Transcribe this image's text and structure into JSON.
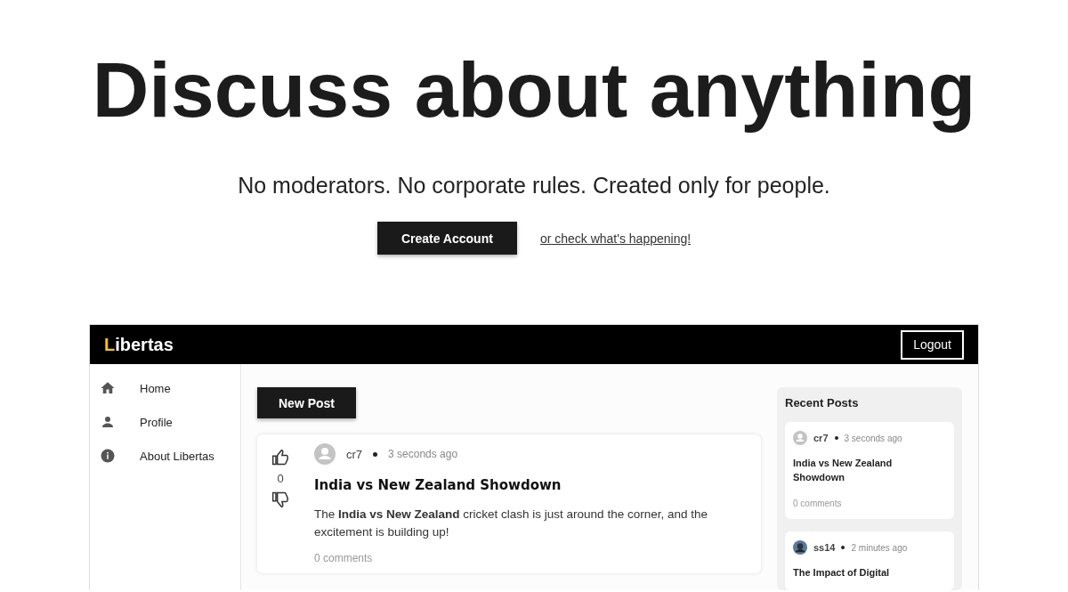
{
  "hero": {
    "title": "Discuss about anything",
    "subtitle": "No moderators. No corporate rules. Created only for people.",
    "primary_button": "Create Account",
    "link": "or check what's happening!"
  },
  "app": {
    "logo": {
      "initial": "L",
      "rest": "ibertas"
    },
    "logout": "Logout",
    "sidebar": {
      "items": [
        {
          "kind": "home",
          "label": "Home"
        },
        {
          "kind": "profile",
          "label": "Profile"
        },
        {
          "kind": "info",
          "label": "About Libertas"
        }
      ]
    },
    "new_post_button": "New Post",
    "posts": [
      {
        "votes": "0",
        "author": "cr7",
        "kind": "default",
        "time": "3 seconds ago",
        "title": "India vs New Zealand Showdown",
        "body": "The **India vs New Zealand** cricket clash is just around the corner, and the excitement is building up!",
        "comments": "0 comments"
      }
    ],
    "recent": {
      "title": "Recent Posts",
      "items": [
        {
          "author": "cr7",
          "kind": "default",
          "time": "3 seconds ago",
          "title": "India vs New Zealand Showdown",
          "comments": "0 comments"
        },
        {
          "author": "ss14",
          "kind": "photo",
          "time": "2 minutes ago",
          "title": "The Impact of Digital"
        }
      ]
    }
  }
}
